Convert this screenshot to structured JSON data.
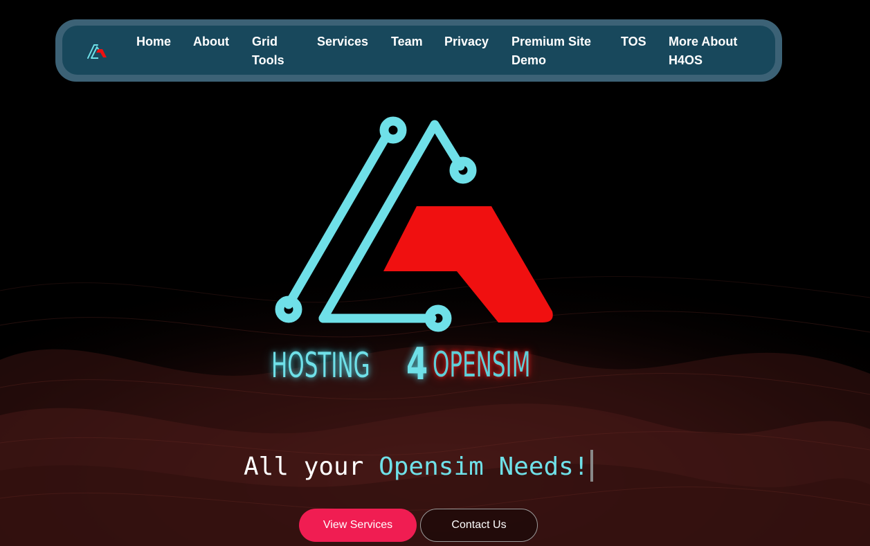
{
  "nav": {
    "logo_icon": "h4os-logo-icon",
    "items": [
      {
        "label": "Home"
      },
      {
        "label": "About"
      },
      {
        "label": "Grid Tools"
      },
      {
        "label": "Services"
      },
      {
        "label": "Team"
      },
      {
        "label": "Privacy"
      },
      {
        "label": "Premium Site Demo"
      },
      {
        "label": "TOS"
      },
      {
        "label": "More About H4OS"
      }
    ]
  },
  "hero": {
    "logo_icon": "hosting4opensim-logo",
    "brand": {
      "part1": "HOSTING",
      "part2": "4",
      "part3": "OPENSIM"
    },
    "tagline": {
      "plain": "All your ",
      "accent": "Opensim Needs!"
    },
    "buttons": {
      "primary": "View Services",
      "secondary": "Contact Us"
    }
  },
  "colors": {
    "background": "#000000",
    "nav_outer": "#3c6276",
    "nav_inner": "#18485c",
    "accent_cyan": "#6fe0e8",
    "accent_red": "#f01010",
    "button_primary": "#f01d52"
  }
}
